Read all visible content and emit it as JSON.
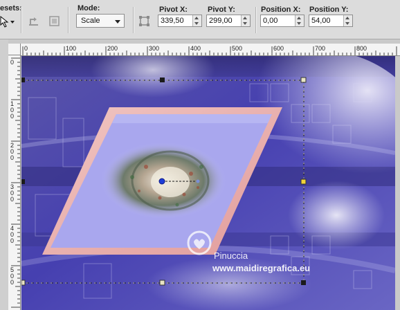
{
  "toolbar": {
    "presets_label": "esets:",
    "mode_label": "Mode:",
    "mode_value": "Scale",
    "pivot_x_label": "Pivot X:",
    "pivot_x_value": "339,50",
    "pivot_y_label": "Pivot Y:",
    "pivot_y_value": "299,00",
    "position_x_label": "Position X:",
    "position_x_value": "0,00",
    "position_y_label": "Position Y:",
    "position_y_value": "54,00"
  },
  "ruler": {
    "h_ticks": [
      "0",
      "100",
      "200",
      "300",
      "400",
      "500",
      "600",
      "700",
      "800"
    ],
    "v_ticks": [
      "0",
      "100",
      "200",
      "300",
      "400",
      "500"
    ]
  },
  "watermark": {
    "name": "Pinuccia",
    "site": "www.maidiregrafica.eu"
  },
  "colors": {
    "frame_pink": "#e9a7a7",
    "panel_lavender": "#a9a7ee",
    "bg_blue": "#4d47b8",
    "toolbar_gray": "#dcdcdc"
  }
}
